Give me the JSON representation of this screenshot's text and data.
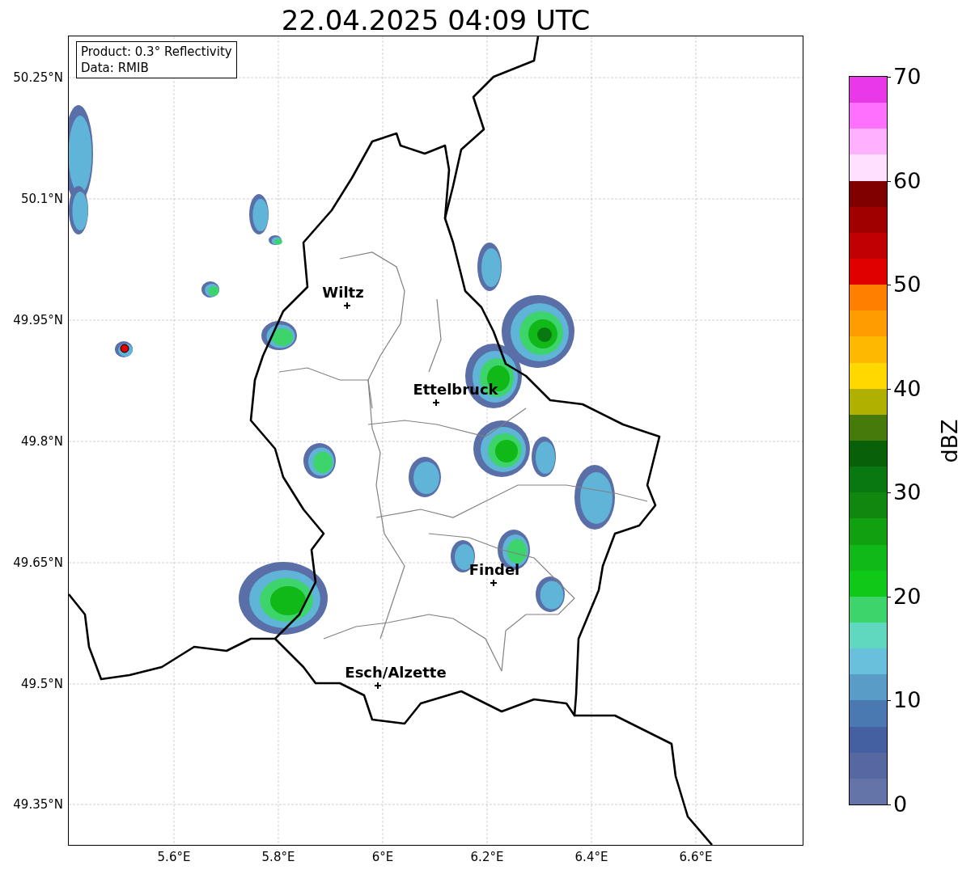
{
  "title": "22.04.2025 04:09 UTC",
  "info_box": [
    "Product: 0.3° Reflectivity",
    "Data: RMIB"
  ],
  "map": {
    "lat_labels": [
      "50.25°N",
      "50.1°N",
      "49.95°N",
      "49.8°N",
      "49.65°N",
      "49.5°N",
      "49.35°N"
    ],
    "lon_labels": [
      "5.6°E",
      "5.8°E",
      "6°E",
      "6.2°E",
      "6.4°E",
      "6.6°E"
    ],
    "cities": [
      {
        "name": "Wiltz"
      },
      {
        "name": "Ettelbruck"
      },
      {
        "name": "Findel"
      },
      {
        "name": "Esch/Alzette"
      }
    ]
  },
  "colorbar": {
    "label": "dBZ",
    "ticks": [
      "70",
      "60",
      "50",
      "40",
      "30",
      "20",
      "10",
      "0"
    ],
    "bins": [
      {
        "color": "#6474a8"
      },
      {
        "color": "#5568a0"
      },
      {
        "color": "#4560a0"
      },
      {
        "color": "#4a78b0"
      },
      {
        "color": "#5a9cc8"
      },
      {
        "color": "#68c0dc"
      },
      {
        "color": "#60d8c0"
      },
      {
        "color": "#3ed46c"
      },
      {
        "color": "#10c818"
      },
      {
        "color": "#10b818"
      },
      {
        "color": "#10a010"
      },
      {
        "color": "#108810"
      },
      {
        "color": "#0a7810"
      },
      {
        "color": "#086008"
      },
      {
        "color": "#467a0a"
      },
      {
        "color": "#b0b000"
      },
      {
        "color": "#ffd800"
      },
      {
        "color": "#ffb800"
      },
      {
        "color": "#ff9c00"
      },
      {
        "color": "#ff8000"
      },
      {
        "color": "#e00000"
      },
      {
        "color": "#c00000"
      },
      {
        "color": "#a00000"
      },
      {
        "color": "#800000"
      },
      {
        "color": "#ffe0ff"
      },
      {
        "color": "#ffb0ff"
      },
      {
        "color": "#ff70ff"
      },
      {
        "color": "#e838e8"
      }
    ]
  }
}
